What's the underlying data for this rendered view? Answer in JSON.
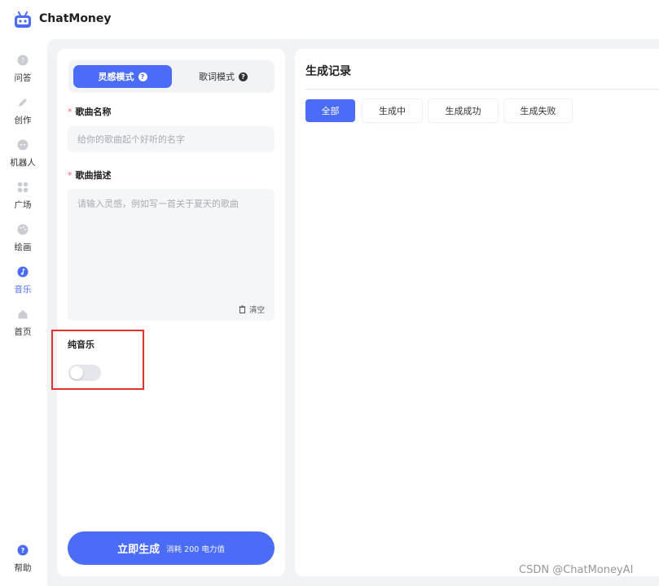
{
  "app": {
    "name": "ChatMoney"
  },
  "sidebar": {
    "items": [
      {
        "label": "问答",
        "icon": "chat-bubble-icon"
      },
      {
        "label": "创作",
        "icon": "pencil-icon"
      },
      {
        "label": "机器人",
        "icon": "robot-icon"
      },
      {
        "label": "广场",
        "icon": "grid-icon"
      },
      {
        "label": "绘画",
        "icon": "palette-icon"
      },
      {
        "label": "音乐",
        "icon": "music-note-icon",
        "active": true
      },
      {
        "label": "首页",
        "icon": "home-icon"
      }
    ],
    "help": {
      "label": "帮助",
      "icon": "help-icon"
    }
  },
  "form": {
    "mode_tabs": [
      {
        "label": "灵感模式",
        "active": true
      },
      {
        "label": "歌词模式",
        "active": false
      }
    ],
    "required_mark": "*",
    "song_name": {
      "label": "歌曲名称",
      "placeholder": "给你的歌曲起个好听的名字",
      "value": ""
    },
    "song_desc": {
      "label": "歌曲描述",
      "placeholder": "请输入灵感，例如写一首关于夏天的歌曲",
      "value": ""
    },
    "clear_label": "清空",
    "pure_music": {
      "label": "纯音乐",
      "enabled": false
    },
    "generate": {
      "label": "立即生成",
      "cost": "消耗 200 电力值"
    }
  },
  "records": {
    "title": "生成记录",
    "filters": [
      {
        "label": "全部",
        "active": true
      },
      {
        "label": "生成中",
        "active": false
      },
      {
        "label": "生成成功",
        "active": false
      },
      {
        "label": "生成失败",
        "active": false
      }
    ]
  },
  "watermark": "CSDN @ChatMoneyAI",
  "colors": {
    "accent": "#4a6cf7",
    "highlight": "#e0322a",
    "required": "#f56c6c",
    "background": "#f2f3f7"
  }
}
